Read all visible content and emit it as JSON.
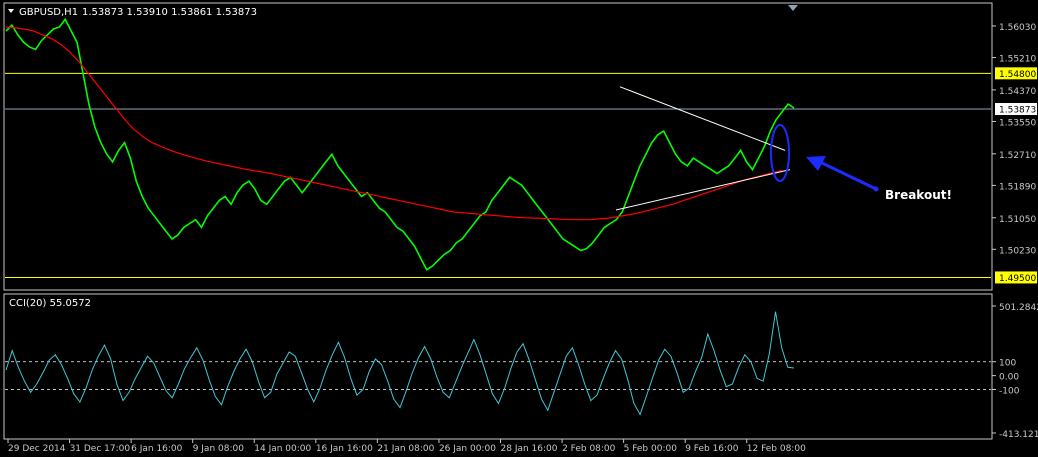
{
  "header": {
    "symbol_timeframe": "GBPUSD,H1",
    "ohlc": "1.53873 1.53910 1.53861 1.53873"
  },
  "colors": {
    "background": "#000000",
    "price_line": "#00ff00",
    "moving_average": "#ff0000",
    "level_line": "#ffff00",
    "current_price_line": "#8fa3b8",
    "trendline": "#ffffff",
    "cci_line": "#3fc8d4",
    "annotation": "#1c2cff",
    "axis": "#c8c8c8"
  },
  "annotation": {
    "text": "Breakout!"
  },
  "chart_data": [
    {
      "type": "line",
      "title": "GBPUSD,H1",
      "ylim": [
        1.492,
        1.566
      ],
      "y_ticks": [
        "1.56030",
        "1.55210",
        "1.54370",
        "1.53550",
        "1.52710",
        "1.51890",
        "1.51050",
        "1.50230"
      ],
      "y_tick_values": [
        1.5603,
        1.5521,
        1.5437,
        1.5355,
        1.5271,
        1.5189,
        1.5105,
        1.5023
      ],
      "x_ticks": [
        "29 Dec 2014",
        "31 Dec 17:00",
        "6 Jan 16:00",
        "9 Jan 08:00",
        "14 Jan 00:00",
        "16 Jan 16:00",
        "21 Jan 08:00",
        "26 Jan 00:00",
        "28 Jan 16:00",
        "2 Feb 08:00",
        "5 Feb 00:00",
        "9 Feb 16:00",
        "12 Feb 08:00"
      ],
      "x_tick_index": [
        0,
        18,
        36,
        54,
        72,
        90,
        108,
        126,
        144,
        162,
        180,
        198,
        216
      ],
      "price_labels": [
        {
          "text": "1.54800",
          "value": 1.548,
          "kind": "level"
        },
        {
          "text": "1.53873",
          "value": 1.53873,
          "kind": "current"
        },
        {
          "text": "1.49500",
          "value": 1.495,
          "kind": "level"
        }
      ],
      "series": [
        {
          "values": [
            1.559,
            1.5605,
            1.558,
            1.556,
            1.5548,
            1.5542,
            1.5565,
            1.558,
            1.5595,
            1.56,
            1.562,
            1.559,
            1.556,
            1.548,
            1.54,
            1.534,
            1.53,
            1.527,
            1.525,
            1.528,
            1.53,
            1.526,
            1.52,
            1.516,
            1.513,
            1.511,
            1.509,
            1.507,
            1.505,
            1.506,
            1.508,
            1.509,
            1.51,
            1.508,
            1.511,
            1.513,
            1.515,
            1.516,
            1.514,
            1.517,
            1.519,
            1.52,
            1.518,
            1.515,
            1.514,
            1.516,
            1.518,
            1.52,
            1.521,
            1.519,
            1.517,
            1.519,
            1.521,
            1.523,
            1.525,
            1.527,
            1.524,
            1.522,
            1.52,
            1.518,
            1.516,
            1.517,
            1.515,
            1.513,
            1.512,
            1.51,
            1.508,
            1.507,
            1.505,
            1.503,
            1.5,
            1.497,
            1.498,
            1.4995,
            1.501,
            1.502,
            1.504,
            1.505,
            1.507,
            1.509,
            1.511,
            1.512,
            1.515,
            1.517,
            1.519,
            1.521,
            1.52,
            1.519,
            1.517,
            1.515,
            1.513,
            1.511,
            1.509,
            1.507,
            1.505,
            1.504,
            1.503,
            1.502,
            1.5025,
            1.504,
            1.506,
            1.508,
            1.509,
            1.51,
            1.512,
            1.516,
            1.52,
            1.524,
            1.527,
            1.53,
            1.532,
            1.533,
            1.53,
            1.527,
            1.525,
            1.524,
            1.526,
            1.525,
            1.524,
            1.523,
            1.522,
            1.523,
            1.524,
            1.526,
            1.528,
            1.525,
            1.523,
            1.526,
            1.529,
            1.533,
            1.536,
            1.538,
            1.54,
            1.539
          ]
        },
        {
          "name": "",
          "values": [
            1.56,
            1.5598,
            1.5595,
            1.559,
            1.558,
            1.557,
            1.5555,
            1.5535,
            1.551,
            1.548,
            1.545,
            1.542,
            1.539,
            1.536,
            1.5335,
            1.5315,
            1.53,
            1.529,
            1.528,
            1.5272,
            1.5265,
            1.5258,
            1.5252,
            1.5247,
            1.5242,
            1.5237,
            1.5232,
            1.5228,
            1.5224,
            1.522,
            1.5215,
            1.521,
            1.5205,
            1.52,
            1.5195,
            1.519,
            1.5185,
            1.518,
            1.5175,
            1.517,
            1.5165,
            1.516,
            1.5155,
            1.515,
            1.5145,
            1.514,
            1.5135,
            1.513,
            1.5125,
            1.512,
            1.5118,
            1.5116,
            1.5114,
            1.5112,
            1.511,
            1.5108,
            1.5106,
            1.5105,
            1.5104,
            1.5103,
            1.5102,
            1.5101,
            1.51,
            1.51,
            1.51,
            1.5102,
            1.5104,
            1.5108,
            1.5112,
            1.5116,
            1.5122,
            1.5128,
            1.5134,
            1.514,
            1.5148,
            1.5156,
            1.5164,
            1.5172,
            1.518,
            1.5188,
            1.5196,
            1.5204,
            1.521,
            1.5216,
            1.5222,
            1.5228
          ]
        }
      ]
    },
    {
      "type": "line",
      "title": "CCI(20) 55.0572",
      "ylim": [
        -413.1211,
        501.2842
      ],
      "y_ticks": [
        "501.2842",
        "100",
        "0.00",
        "-100",
        "-413.1211"
      ],
      "y_tick_values": [
        501.2842,
        100,
        0,
        -100,
        -413.1211
      ],
      "levels": [
        100,
        -100
      ],
      "series": [
        {
          "name": "CCI(20) 55.0572",
          "values": [
            40,
            180,
            60,
            -40,
            -120,
            -60,
            20,
            110,
            150,
            80,
            -20,
            -130,
            -190,
            -90,
            40,
            140,
            220,
            120,
            -60,
            -180,
            -120,
            -20,
            60,
            140,
            90,
            -10,
            -110,
            -160,
            -60,
            50,
            130,
            200,
            110,
            -30,
            -150,
            -210,
            -80,
            30,
            120,
            190,
            100,
            -40,
            -160,
            -120,
            10,
            90,
            170,
            140,
            20,
            -100,
            -190,
            -90,
            40,
            150,
            240,
            130,
            -20,
            -140,
            -100,
            30,
            120,
            80,
            -40,
            -170,
            -230,
            -110,
            20,
            130,
            210,
            120,
            -10,
            -120,
            -160,
            -50,
            60,
            160,
            260,
            150,
            10,
            -130,
            -200,
            -90,
            50,
            170,
            230,
            110,
            -30,
            -170,
            -250,
            -120,
            10,
            140,
            200,
            80,
            -60,
            -180,
            -140,
            -20,
            90,
            180,
            120,
            -30,
            -200,
            -280,
            -150,
            -20,
            110,
            190,
            140,
            20,
            -120,
            -90,
            30,
            130,
            300,
            180,
            40,
            -80,
            -60,
            60,
            150,
            100,
            -20,
            -40,
            160,
            460,
            200,
            60,
            55
          ]
        }
      ]
    }
  ]
}
